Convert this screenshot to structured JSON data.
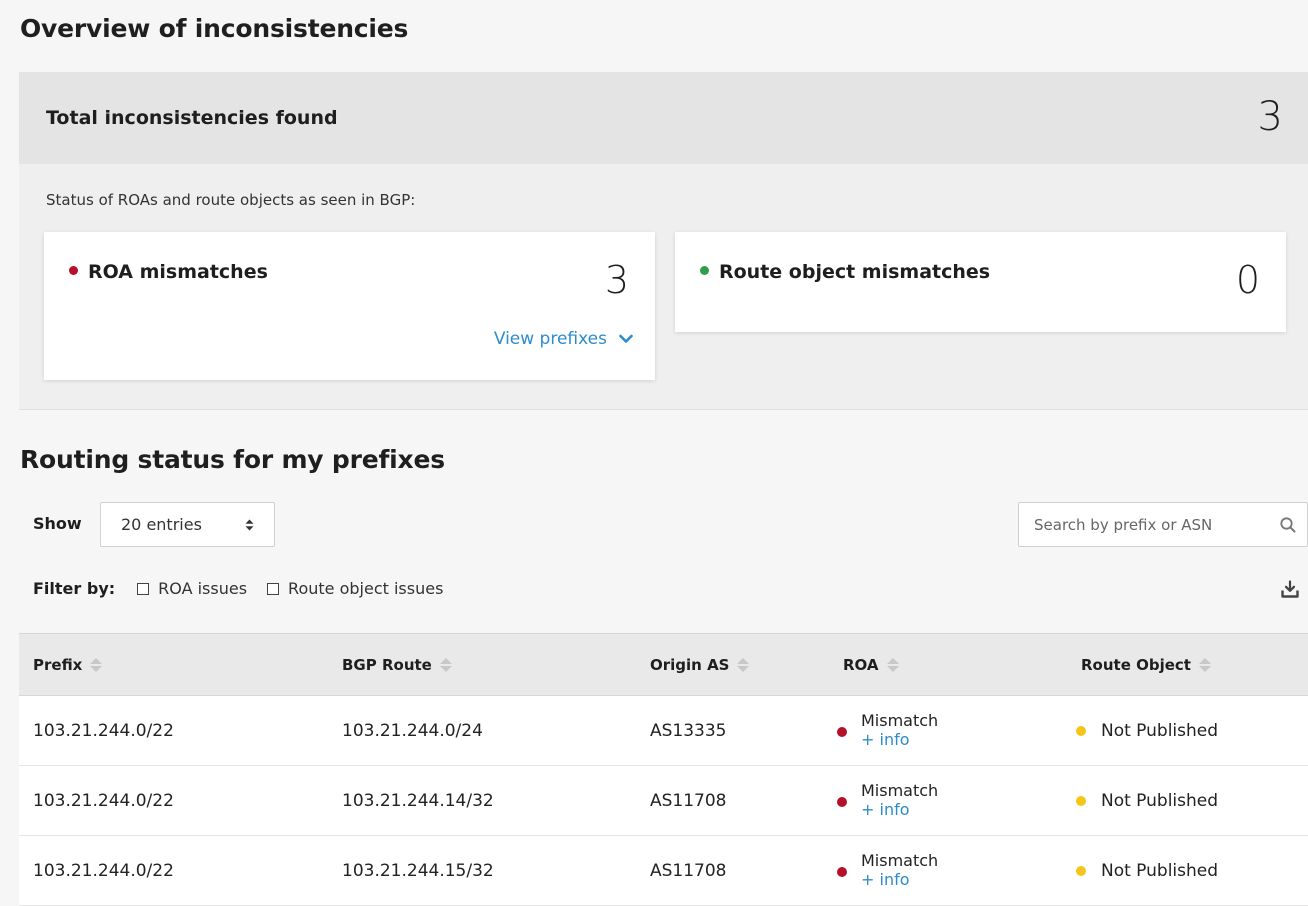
{
  "overview": {
    "title": "Overview of inconsistencies",
    "total_label": "Total inconsistencies found",
    "total_count": "3",
    "subtitle": "Status of ROAs and route objects as seen in BGP:",
    "roa_card": {
      "title": "ROA mismatches",
      "count": "3",
      "link": "View prefixes",
      "dot_color": "#b5102a"
    },
    "route_card": {
      "title": "Route object mismatches",
      "count": "0",
      "dot_color": "#2e9e49"
    }
  },
  "routing": {
    "title": "Routing status for my prefixes",
    "show_label": "Show",
    "entries_selected": "20 entries",
    "search_placeholder": "Search by prefix or ASN",
    "filter_label": "Filter by:",
    "filters": [
      "ROA issues",
      "Route object issues"
    ]
  },
  "table": {
    "columns": [
      "Prefix",
      "BGP Route",
      "Origin AS",
      "ROA",
      "Route Object"
    ],
    "rows": [
      {
        "prefix": "103.21.244.0/22",
        "bgp_route": "103.21.244.0/24",
        "origin_as": "AS13335",
        "roa": "Mismatch",
        "roa_link": "+ info",
        "route_object": "Not Published"
      },
      {
        "prefix": "103.21.244.0/22",
        "bgp_route": "103.21.244.14/32",
        "origin_as": "AS11708",
        "roa": "Mismatch",
        "roa_link": "+ info",
        "route_object": "Not Published"
      },
      {
        "prefix": "103.21.244.0/22",
        "bgp_route": "103.21.244.15/32",
        "origin_as": "AS11708",
        "roa": "Mismatch",
        "roa_link": "+ info",
        "route_object": "Not Published"
      }
    ]
  },
  "colors": {
    "accent": "#2d8ccc",
    "mismatch": "#b5102a",
    "not_published": "#f5c518",
    "ok": "#2e9e49"
  }
}
